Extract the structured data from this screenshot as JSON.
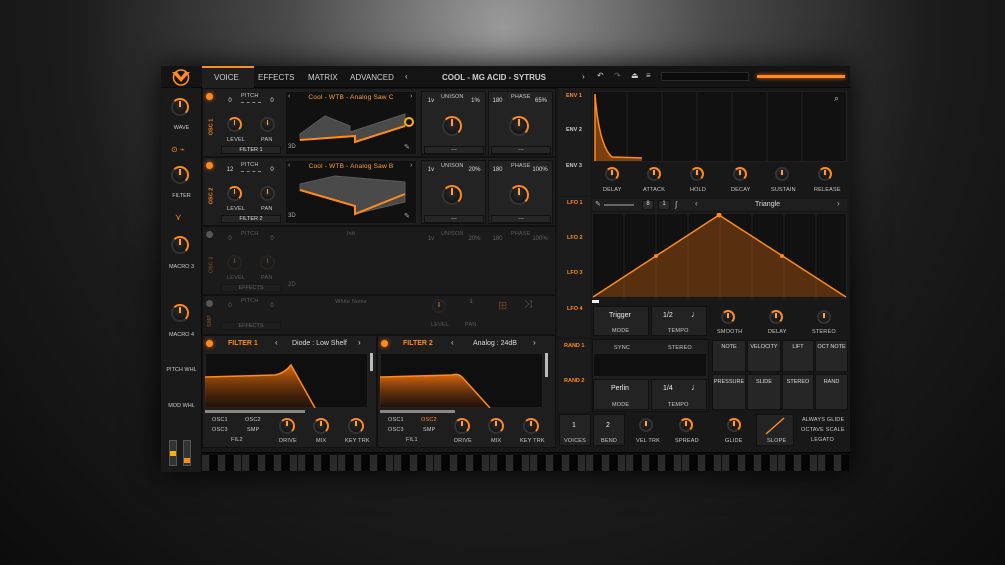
{
  "header": {
    "tabs": [
      "VOICE",
      "EFFECTS",
      "MATRIX",
      "ADVANCED"
    ],
    "preset": "COOL - MG ACID  - SYTRUS"
  },
  "sidebar": {
    "items": [
      "WAVE",
      "FILTER",
      "MACRO 3",
      "MACRO 4",
      "PITCH WHL",
      "MOD WHL"
    ]
  },
  "osc": [
    {
      "name": "OSC 1",
      "pitch_label": "PITCH",
      "pitch_l": "0",
      "pitch_r": "0",
      "wave": "Cool - WTB - Analog Saw C",
      "level": "LEVEL",
      "pan": "PAN",
      "filter": "FILTER 1",
      "unison": "UNISON",
      "voices": "1v",
      "detune": "1%",
      "phase_label": "PHASE",
      "phase_l": "180",
      "phase_r": "65%",
      "view": "3D",
      "dash": "---"
    },
    {
      "name": "OSC 2",
      "pitch_label": "PITCH",
      "pitch_l": "12",
      "pitch_r": "0",
      "wave": "Cool - WTB - Analog Saw B",
      "level": "LEVEL",
      "pan": "PAN",
      "filter": "FILTER 2",
      "unison": "UNISON",
      "voices": "1v",
      "detune": "20%",
      "phase_label": "PHASE",
      "phase_l": "180",
      "phase_r": "100%",
      "view": "3D",
      "dash": "---"
    },
    {
      "name": "OSC 3",
      "pitch_label": "PITCH",
      "pitch_l": "0",
      "pitch_r": "0",
      "wave": "Init",
      "level": "LEVEL",
      "pan": "PAN",
      "filter": "EFFECTS",
      "unison": "UNISON",
      "voices": "1v",
      "detune": "20%",
      "phase_label": "PHASE",
      "phase_l": "180",
      "phase_r": "100%",
      "view": "2D",
      "dash": "---"
    }
  ],
  "smp": {
    "name": "SMP",
    "pitch_label": "PITCH",
    "pitch_l": "0",
    "pitch_r": "0",
    "wave": "White Noise",
    "filter": "EFFECTS",
    "level": "LEVEL",
    "pan": "PAN",
    "pan_val": "1"
  },
  "filters": [
    {
      "name": "FILTER 1",
      "type": "Diode : Low Shelf",
      "r1a": "OSC1",
      "r1b": "OSC2",
      "r2a": "OSC3",
      "r2b": "SMP",
      "route": "FIL2",
      "knobs": [
        "DRIVE",
        "MIX",
        "KEY TRK"
      ]
    },
    {
      "name": "FILTER 2",
      "type": "Analog : 24dB",
      "r1a": "OSC1",
      "r1b": "OSC2",
      "r2a": "OSC3",
      "r2b": "SMP",
      "route": "FIL1",
      "knobs": [
        "DRIVE",
        "MIX",
        "KEY TRK"
      ]
    }
  ],
  "env": {
    "tabs": [
      "ENV 1",
      "ENV 2",
      "ENV 3"
    ],
    "knobs": [
      "DELAY",
      "ATTACK",
      "HOLD",
      "DECAY",
      "SUSTAIN",
      "RELEASE"
    ]
  },
  "lfo": {
    "tabs": [
      "LFO 1",
      "LFO 2",
      "LFO 3",
      "LFO 4"
    ],
    "shape": "Triangle",
    "n1": "8",
    "n2": "1",
    "mode": "Trigger",
    "mode_label": "MODE",
    "tempo": "1/2",
    "tempo_label": "TEMPO",
    "knobs": [
      "SMOOTH",
      "DELAY",
      "STEREO"
    ]
  },
  "rand": {
    "tabs": [
      "RAND 1",
      "RAND 2"
    ],
    "sync": "SYNC",
    "stereo": "STEREO",
    "mode": "Perlin",
    "mode_label": "MODE",
    "tempo": "1/4",
    "tempo_label": "TEMPO"
  },
  "mods": [
    "NOTE",
    "VELOCITY",
    "LIFT",
    "OCT NOTE",
    "PRESSURE",
    "SLIDE",
    "STEREO",
    "RAND"
  ],
  "voice": {
    "voices": "1",
    "voices_label": "VOICES",
    "bend": "2",
    "bend_label": "BEND",
    "vel": "VEL TRK",
    "spread": "SPREAD",
    "glide": "GLIDE",
    "slope": "SLOPE",
    "always": "ALWAYS GLIDE",
    "octave": "OCTAVE SCALE",
    "legato": "LEGATO"
  },
  "colors": {
    "accent": "#ff8a1e",
    "bg": "#181818"
  }
}
